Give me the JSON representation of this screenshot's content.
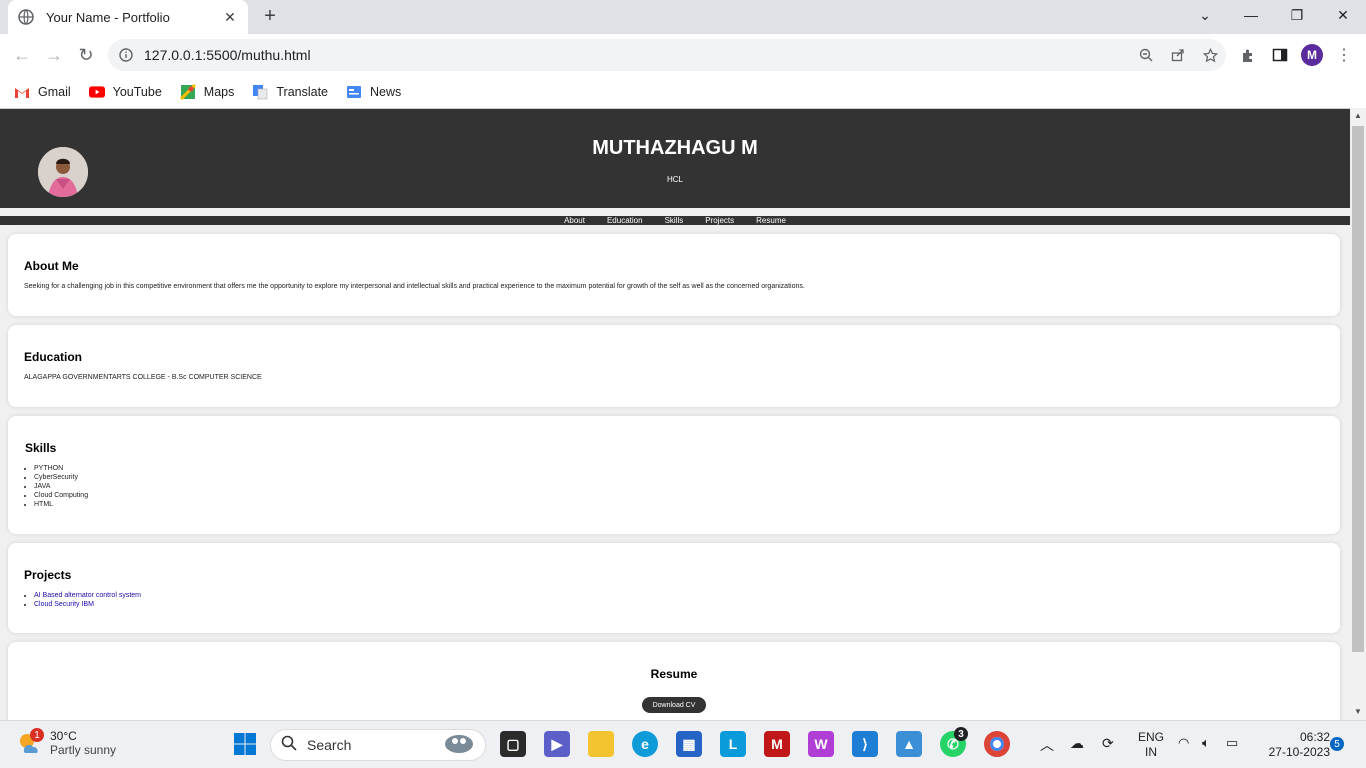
{
  "browser": {
    "tab_title": "Your Name - Portfolio",
    "url": "127.0.0.1:5500/muthu.html",
    "profile_initial": "M",
    "bookmarks": [
      {
        "label": "Gmail",
        "icon": "gmail-icon"
      },
      {
        "label": "YouTube",
        "icon": "youtube-icon"
      },
      {
        "label": "Maps",
        "icon": "maps-icon"
      },
      {
        "label": "Translate",
        "icon": "translate-icon"
      },
      {
        "label": "News",
        "icon": "news-icon"
      }
    ]
  },
  "page": {
    "name": "MUTHAZHAGU M",
    "company": "HCL",
    "nav": [
      "About",
      "Education",
      "Skills",
      "Projects",
      "Resume"
    ],
    "about": {
      "title": "About Me",
      "text": "Seeking for a challenging job in this competitive environment that offers me the opportunity to explore my interpersonal and intellectual skills and practical experience to the maximum potential for growth of the self as well as the concerned organizations."
    },
    "education": {
      "title": "Education",
      "text": "ALAGAPPA GOVERNMENTARTS COLLEGE - B.Sc COMPUTER SCIENCE"
    },
    "skills": {
      "title": "Skills",
      "items": [
        "PYTHON",
        "CyberSecurity",
        "JAVA",
        "Cloud Computing",
        "HTML"
      ]
    },
    "projects": {
      "title": "Projects",
      "items": [
        "AI Based alternator control system",
        "Cloud Security IBM"
      ]
    },
    "resume": {
      "title": "Resume",
      "button": "Download CV"
    }
  },
  "taskbar": {
    "weather_temp": "30°C",
    "weather_cond": "Partly sunny",
    "weather_badge": "1",
    "search_label": "Search",
    "whatsapp_badge": "3",
    "lang_top": "ENG",
    "lang_bottom": "IN",
    "time": "06:32",
    "date": "27-10-2023",
    "notif_count": "5"
  },
  "colors": {
    "header_bg": "#333333",
    "link": "#1a0dab",
    "avatar_bg": "#5b2a9c"
  }
}
